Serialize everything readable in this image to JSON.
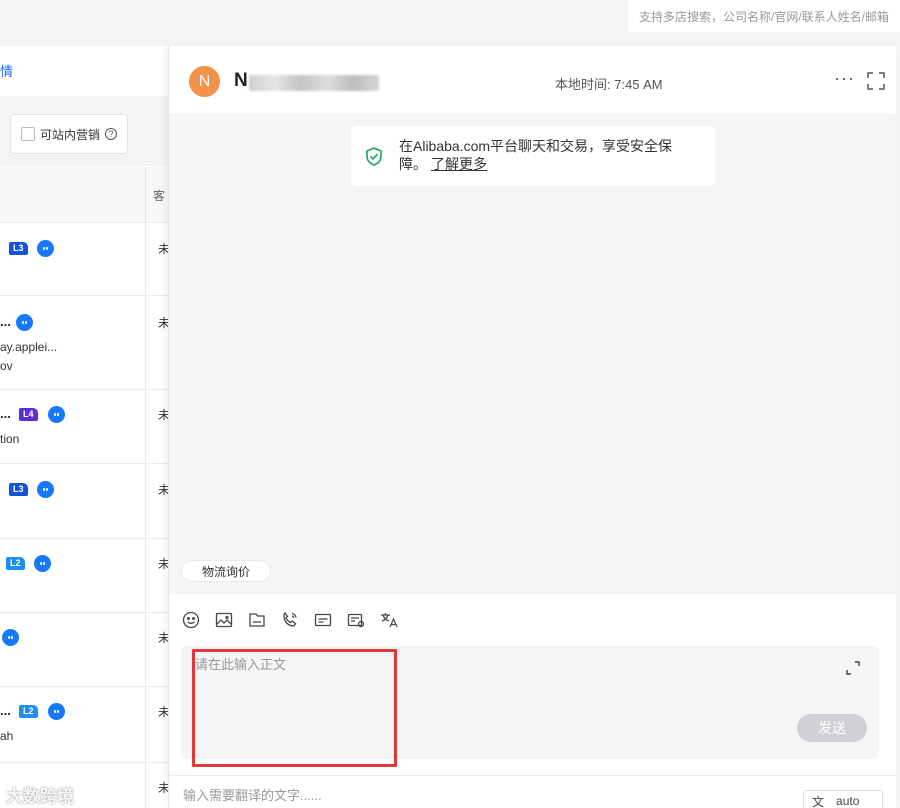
{
  "search": {
    "placeholder": "支持多店搜索，公司名称/官网/联系人姓名/邮箱"
  },
  "left_panel": {
    "link_text": "情",
    "checkbox_label": "可站内营销",
    "column_header": "客",
    "rows": [
      {
        "name_tail": "",
        "sub1": "",
        "sub2": "",
        "level": "L3",
        "mark": "未"
      },
      {
        "name_tail": "...",
        "sub1": "ay.applei...",
        "sub2": "ov",
        "level": "",
        "mark": "未"
      },
      {
        "name_tail": "...",
        "sub1": "tion",
        "sub2": "",
        "level": "L4",
        "mark": "未"
      },
      {
        "name_tail": "",
        "sub1": "",
        "sub2": "",
        "level": "L3",
        "mark": "未"
      },
      {
        "name_tail": "",
        "sub1": "",
        "sub2": "",
        "level": "L2",
        "mark": "未"
      },
      {
        "name_tail": "",
        "sub1": "",
        "sub2": "",
        "level": "",
        "mark": "未"
      },
      {
        "name_tail": "...",
        "sub1": "ah",
        "sub2": "",
        "level": "L2",
        "mark": "未"
      }
    ]
  },
  "chat": {
    "avatar_letter": "N",
    "contact_name": "N",
    "local_time": "本地时间: 7:45 AM",
    "more_label": "···",
    "notice_text": "在Alibaba.com平台聊天和交易，享受安全保障。",
    "notice_link": "了解更多",
    "chip_label": "物流询价",
    "input_placeholder": "请在此输入正文",
    "send_label": "发送",
    "translate_placeholder": "输入需要翻译的文字......",
    "lang_value": "auto"
  },
  "watermark": "大数跨境",
  "colors": {
    "accent": "#1a66ff",
    "avatar": "#f3924a",
    "highlight": "#e0393b",
    "send_disabled": "#cfd1d4"
  }
}
